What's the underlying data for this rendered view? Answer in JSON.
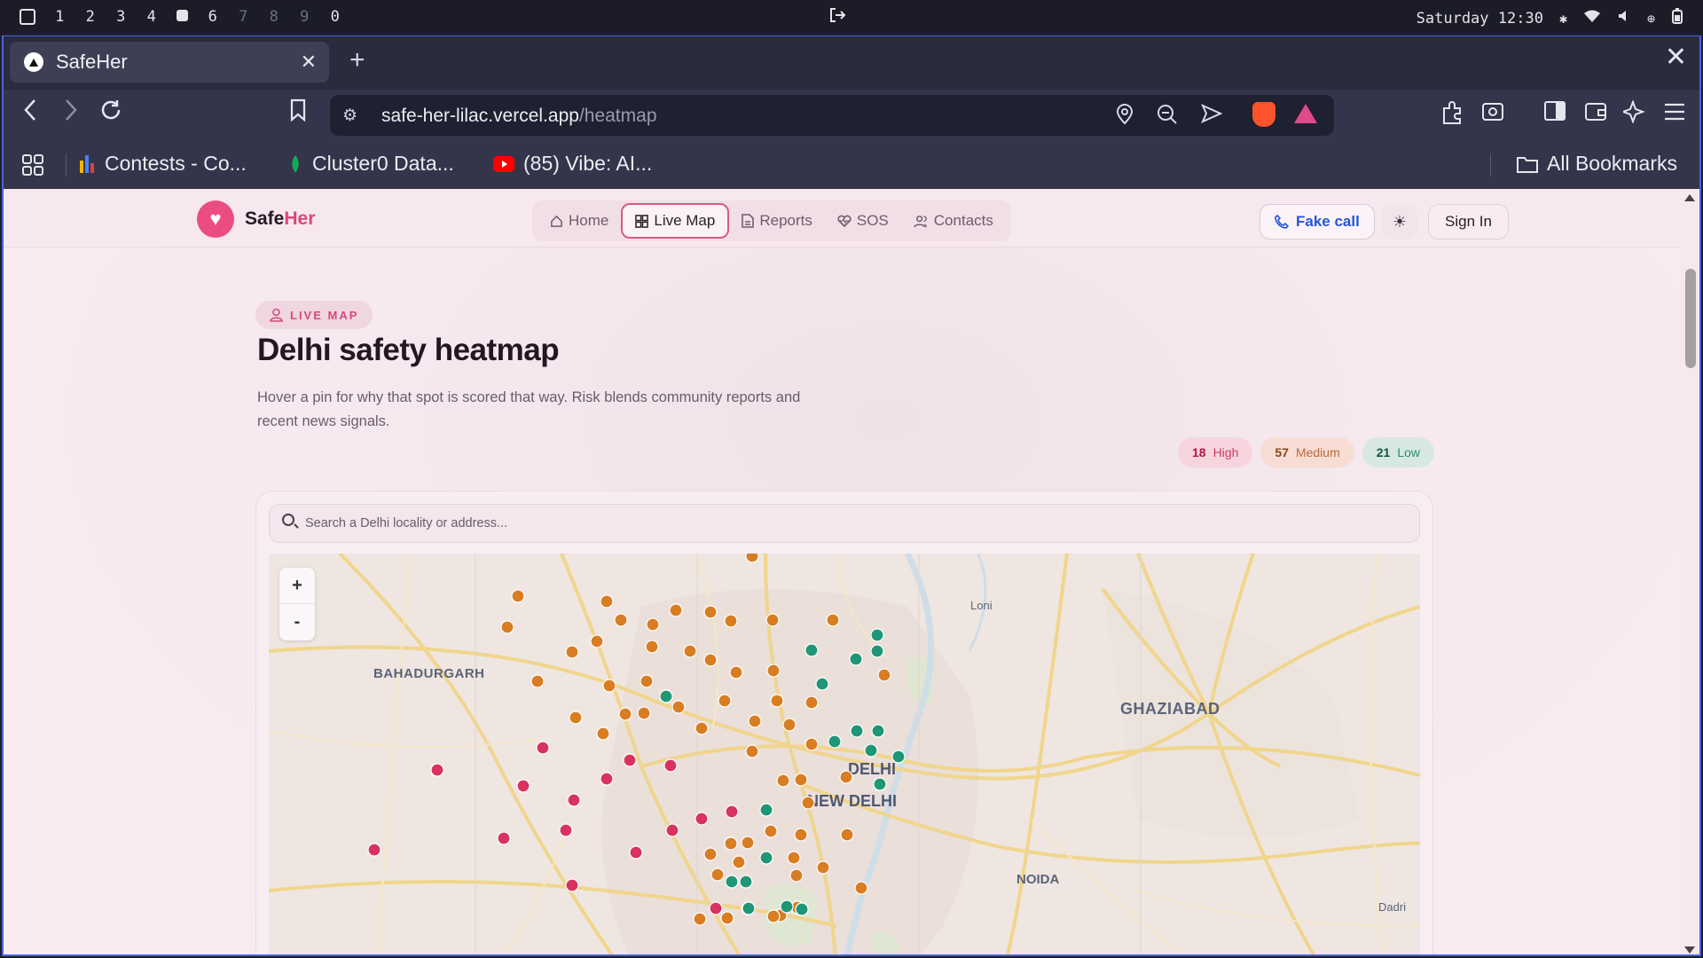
{
  "os": {
    "workspaces": [
      "1",
      "2",
      "3",
      "4",
      "5",
      "6",
      "7",
      "8",
      "9",
      "0"
    ],
    "active_workspace": "5",
    "center_icon": "logout-icon",
    "clock": "Saturday 12:30"
  },
  "browser": {
    "tab_title": "SafeHer",
    "url_host": "safe-her-lilac.vercel.app",
    "url_path": "/heatmap",
    "bookmarks": [
      {
        "label": "Contests - Co...",
        "icon": "bar-chart-icon"
      },
      {
        "label": "Cluster0 Data...",
        "icon": "mongodb-leaf-icon"
      },
      {
        "label": "(85) Vibe: AI...",
        "icon": "youtube-icon"
      }
    ],
    "all_bookmarks": "All Bookmarks"
  },
  "app": {
    "brand_a": "Safe",
    "brand_b": "Her",
    "nav": [
      {
        "label": "Home",
        "icon": "home-icon",
        "active": false
      },
      {
        "label": "Live Map",
        "icon": "grid-icon",
        "active": true
      },
      {
        "label": "Reports",
        "icon": "document-icon",
        "active": false
      },
      {
        "label": "SOS",
        "icon": "heart-pulse-icon",
        "active": false
      },
      {
        "label": "Contacts",
        "icon": "users-icon",
        "active": false
      }
    ],
    "fake_call": "Fake call",
    "sign_in": "Sign In"
  },
  "hero": {
    "badge": "LIVE MAP",
    "title": "Delhi safety heatmap",
    "description": "Hover a pin for why that spot is scored that way. Risk blends community reports and recent news signals.",
    "stats": {
      "high": {
        "count": "18",
        "label": "High"
      },
      "medium": {
        "count": "57",
        "label": "Medium"
      },
      "low": {
        "count": "21",
        "label": "Low"
      }
    }
  },
  "map": {
    "search_placeholder": "Search a Delhi locality or address...",
    "zoom_in": "+",
    "zoom_out": "-",
    "place_labels": [
      "BAHADURGARH",
      "Loni",
      "GHAZIABAD",
      "DELHI",
      "NEW DELHI",
      "NOIDA",
      "Dadri"
    ],
    "colors": {
      "high": "#d8325f",
      "medium": "#d97d22",
      "low": "#1f9675"
    }
  }
}
